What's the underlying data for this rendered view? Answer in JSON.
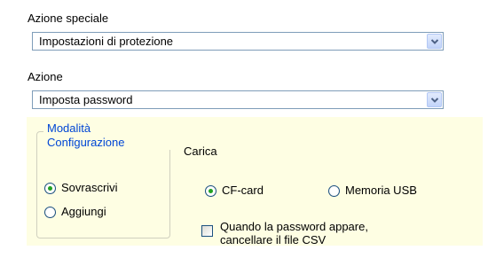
{
  "special_action": {
    "label": "Azione speciale",
    "selected": "Impostazioni di protezione"
  },
  "action": {
    "label": "Azione",
    "selected": "Imposta password"
  },
  "mode_group": {
    "title": "Modalità Configurazione",
    "options": [
      {
        "label": "Sovrascrivi",
        "checked": true
      },
      {
        "label": "Aggiungi",
        "checked": false
      }
    ]
  },
  "load": {
    "label": "Carica",
    "options": [
      {
        "label": "CF-card",
        "checked": true
      },
      {
        "label": "Memoria USB",
        "checked": false
      }
    ]
  },
  "delete_csv": {
    "line1": "Quando la password appare,",
    "line2": "cancellare il file CSV",
    "checked": false
  },
  "colors": {
    "panel_background": "#fefee3",
    "group_title": "#0046d5",
    "combo_border": "#7f9db9",
    "radio_dot": "#21a121"
  },
  "icons": {
    "dropdown": "chevron-down-icon"
  }
}
